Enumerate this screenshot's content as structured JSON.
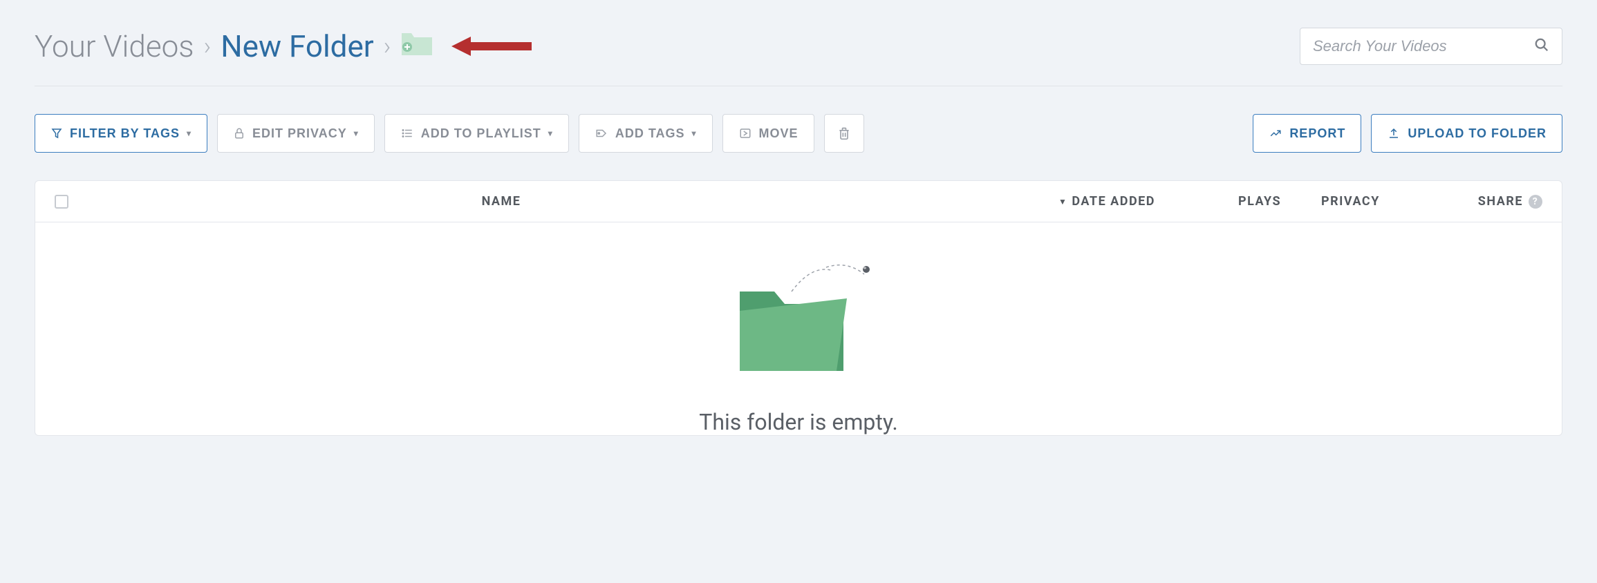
{
  "breadcrumb": {
    "root": "Your Videos",
    "current": "New Folder"
  },
  "search": {
    "placeholder": "Search Your Videos"
  },
  "toolbar": {
    "filter_tags": "FILTER BY TAGS",
    "edit_privacy": "EDIT PRIVACY",
    "add_playlist": "ADD TO PLAYLIST",
    "add_tags": "ADD TAGS",
    "move": "MOVE",
    "report": "REPORT",
    "upload": "UPLOAD TO FOLDER"
  },
  "table": {
    "columns": {
      "name": "NAME",
      "date_added": "DATE ADDED",
      "plays": "PLAYS",
      "privacy": "PRIVACY",
      "share": "SHARE"
    }
  },
  "empty": {
    "message": "This folder is empty."
  }
}
